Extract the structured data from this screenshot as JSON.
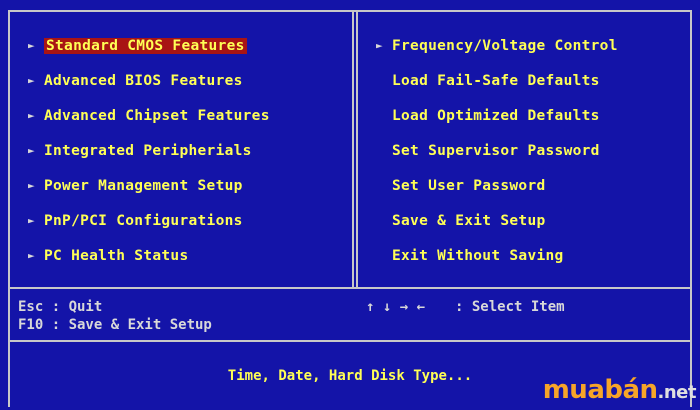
{
  "left_menu": [
    {
      "label": "Standard CMOS Features",
      "arrow": "►",
      "selected": true
    },
    {
      "label": "Advanced BIOS Features",
      "arrow": "►"
    },
    {
      "label": "Advanced Chipset Features",
      "arrow": "►"
    },
    {
      "label": "Integrated Peripherials",
      "arrow": "►"
    },
    {
      "label": "Power Management Setup",
      "arrow": "►"
    },
    {
      "label": "PnP/PCI Configurations",
      "arrow": "►"
    },
    {
      "label": "PC Health Status",
      "arrow": "►"
    }
  ],
  "right_menu": [
    {
      "label": "Frequency/Voltage Control",
      "arrow": "►"
    },
    {
      "label": "Load Fail-Safe Defaults",
      "arrow": ""
    },
    {
      "label": "Load Optimized Defaults",
      "arrow": ""
    },
    {
      "label": "Set Supervisor Password",
      "arrow": ""
    },
    {
      "label": "Set User Password",
      "arrow": ""
    },
    {
      "label": "Save & Exit Setup",
      "arrow": ""
    },
    {
      "label": "Exit Without Saving",
      "arrow": ""
    }
  ],
  "help": {
    "esc": "Esc : Quit",
    "f10": "F10 : Save & Exit Setup",
    "arrows": "↑ ↓ → ←",
    "select": ": Select Item"
  },
  "description": "Time, Date, Hard Disk Type...",
  "watermark": {
    "brand": "muabán",
    "tld": ".net"
  },
  "colors": {
    "background": "#1414a8",
    "menu_text": "#ffff55",
    "highlight": "#a81414",
    "frame": "#c8c8c8"
  }
}
